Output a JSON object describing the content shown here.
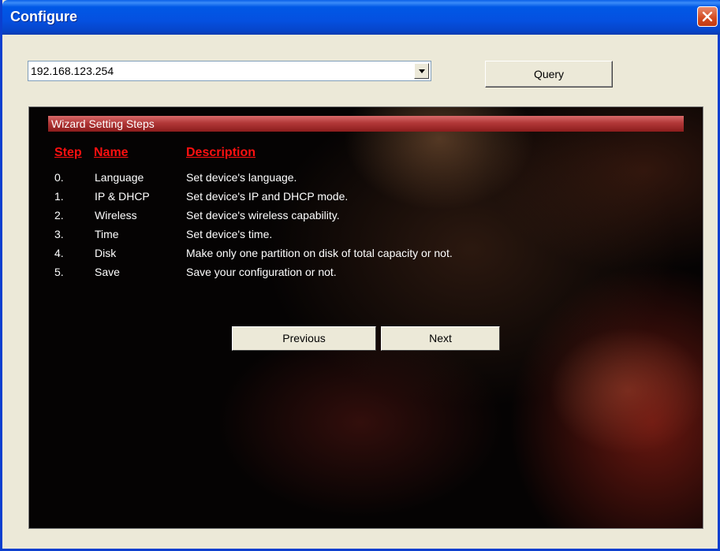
{
  "window": {
    "title": "Configure"
  },
  "address": {
    "value": "192.168.123.254"
  },
  "toolbar": {
    "query_label": "Query"
  },
  "wizard": {
    "header": "Wizard Setting Steps",
    "columns": {
      "step": "Step",
      "name": "Name",
      "description": "Description"
    },
    "steps": [
      {
        "step": "0.",
        "name": "Language",
        "description": "Set device's language."
      },
      {
        "step": "1.",
        "name": "IP & DHCP",
        "description": "Set device's IP and DHCP mode."
      },
      {
        "step": "2.",
        "name": "Wireless",
        "description": "Set device's wireless capability."
      },
      {
        "step": "3.",
        "name": "Time",
        "description": "Set device's time."
      },
      {
        "step": "4.",
        "name": "Disk",
        "description": "Make only one partition on disk of total capacity or not."
      },
      {
        "step": "5.",
        "name": "Save",
        "description": "Save your configuration or not."
      }
    ],
    "previous_label": "Previous",
    "next_label": "Next"
  },
  "colors": {
    "title_bar": "#0058e6",
    "header_bar": "#b23838",
    "column_heading": "#ff1010",
    "panel_background": "#050303"
  },
  "icons": {
    "close": "close-icon",
    "dropdown": "chevron-down-icon"
  }
}
